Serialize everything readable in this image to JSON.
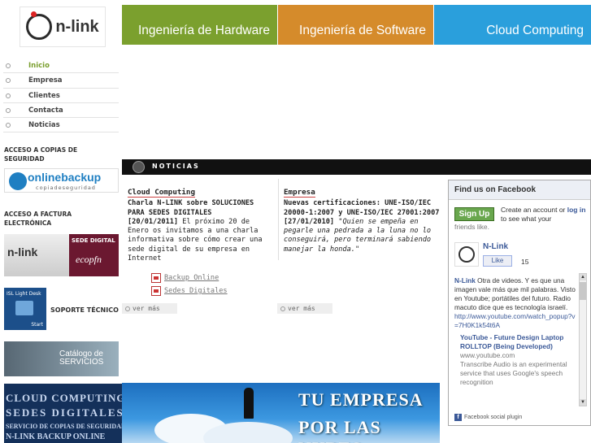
{
  "logo": {
    "text": "n-link"
  },
  "menu": [
    {
      "label": "Inicio",
      "active": true
    },
    {
      "label": "Empresa",
      "active": false
    },
    {
      "label": "Clientes",
      "active": false
    },
    {
      "label": "Contacta",
      "active": false
    },
    {
      "label": "Noticias",
      "active": false
    }
  ],
  "sidebar": {
    "copias_heading": "ACCESO A COPIAS DE SEGURIDAD",
    "onlinebackup_title": "onlinebackup",
    "onlinebackup_sub": "copiadeseguridad",
    "factura_heading": "ACCESO A FACTURA ELECTRÓNICA",
    "sede_logo": "n-link",
    "sede_label": "SEDE DIGITAL",
    "sede_brand": "ecopfn",
    "isl_label": "ISL Light Desk",
    "isl_start": "Start",
    "soporte": "SOPORTE TÉCNICO",
    "catalogo": "Catálogo de SERVICIOS",
    "cloud_lines": [
      "CLOUD COMPUTING",
      "SEDES DIGITALES",
      "SERVICIO DE COPIAS DE SEGURIDAD",
      "N-LINK BACKUP ONLINE"
    ]
  },
  "topnav": {
    "hardware": "Ingeniería de Hardware",
    "software": "Ingeniería de Software",
    "cloud": "Cloud Computing"
  },
  "noticias": {
    "bar_title": "NOTICIAS",
    "item1": {
      "category": "Cloud Computing",
      "headline": "Charla N-LINK sobre SOLUCIONES PARA SEDES DIGITALES",
      "date": "[20/01/2011]",
      "body": " El próximo 20 de Enero os invitamos a una charla informativa sobre cómo crear una sede digital de su empresa en Internet"
    },
    "item2": {
      "category": "Empresa",
      "headline": "Nuevas certificaciones: UNE-ISO/IEC 20000-1:2007 y UNE-ISO/IEC 27001:2007",
      "date": "[27/01/2010]",
      "quote": " \"Quien se empeña en pegarle una pedrada a la luna no lo conseguirá, pero terminará sabiendo manejar la honda.\""
    },
    "links": [
      "Backup Online",
      "Sedes Digitales"
    ],
    "ver_mas": "ver más"
  },
  "banner": {
    "line1": "TU EMPRESA",
    "line2": "POR LAS NUBES"
  },
  "facebook": {
    "title": "Find us on Facebook",
    "signup": "Sign Up",
    "create_text": "Create an account or ",
    "login": "log in",
    "create_tail": " to see what your",
    "friends_like": "friends like.",
    "page_name": "N-Link",
    "like": "Like",
    "like_count": "15",
    "post_author": "N-Link",
    "post_text": " Otra de videos. Y es que una imagen vale más que mil palabras. Visto en Youtube; portátiles del futuro. Radio macuto dice que es tecnología israelí.",
    "post_link": "http://www.youtube.com/watch_popup?v=7H0K1k54t6A",
    "card_title": "YouTube - Future Design Laptop ROLLTOP (Being Developed)",
    "card_domain": "www.youtube.com",
    "card_desc": "Transcribe Audio is an experimental service that uses Google's speech recognition",
    "plugin": "Facebook social plugin"
  }
}
